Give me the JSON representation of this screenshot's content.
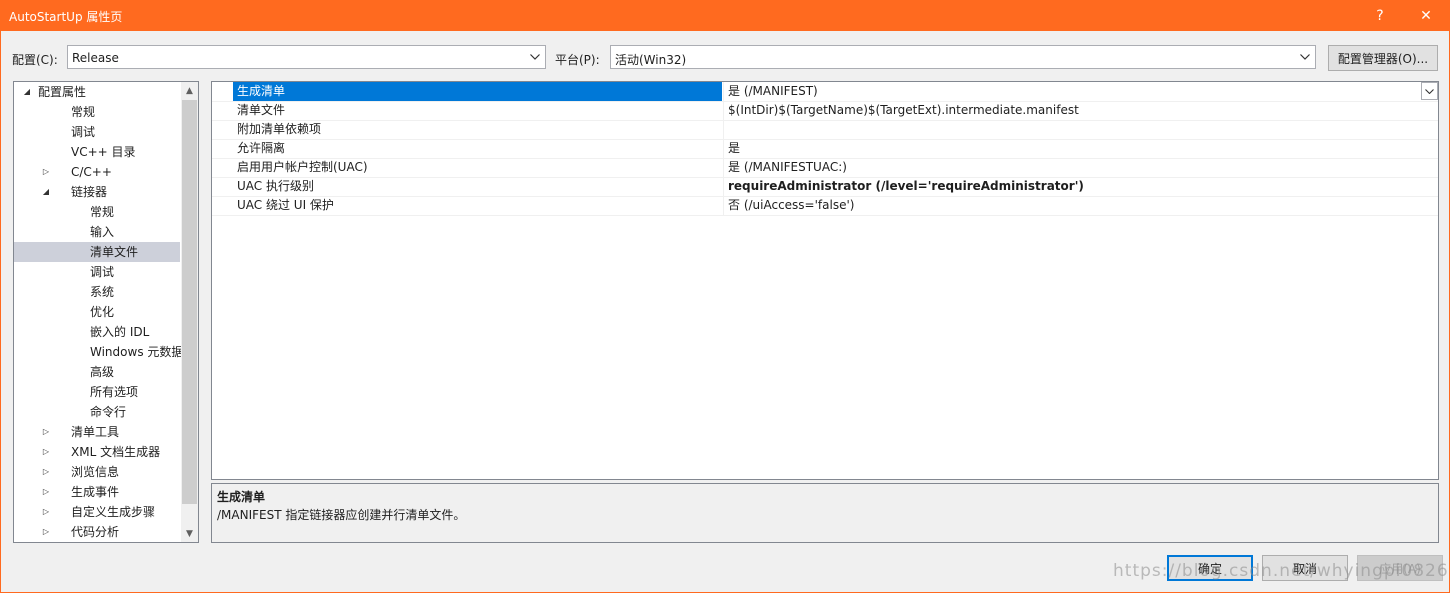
{
  "window": {
    "title": "AutoStartUp 属性页",
    "help_label": "?",
    "close_label": "✕"
  },
  "config": {
    "config_label": "配置(C):",
    "config_value": "Release",
    "platform_label": "平台(P):",
    "platform_value": "活动(Win32)",
    "manager_button": "配置管理器(O)..."
  },
  "tree": {
    "items": [
      {
        "label": "配置属性",
        "level": 0,
        "expander": "◢",
        "selected": false
      },
      {
        "label": "常规",
        "level": 1,
        "expander": "",
        "selected": false
      },
      {
        "label": "调试",
        "level": 1,
        "expander": "",
        "selected": false
      },
      {
        "label": "VC++ 目录",
        "level": 1,
        "expander": "",
        "selected": false
      },
      {
        "label": "C/C++",
        "level": 1,
        "expander": "▷",
        "selected": false
      },
      {
        "label": "链接器",
        "level": 1,
        "expander": "◢",
        "selected": false
      },
      {
        "label": "常规",
        "level": 2,
        "expander": "",
        "selected": false
      },
      {
        "label": "输入",
        "level": 2,
        "expander": "",
        "selected": false
      },
      {
        "label": "清单文件",
        "level": 2,
        "expander": "",
        "selected": true
      },
      {
        "label": "调试",
        "level": 2,
        "expander": "",
        "selected": false
      },
      {
        "label": "系统",
        "level": 2,
        "expander": "",
        "selected": false
      },
      {
        "label": "优化",
        "level": 2,
        "expander": "",
        "selected": false
      },
      {
        "label": "嵌入的 IDL",
        "level": 2,
        "expander": "",
        "selected": false
      },
      {
        "label": "Windows 元数据",
        "level": 2,
        "expander": "",
        "selected": false
      },
      {
        "label": "高级",
        "level": 2,
        "expander": "",
        "selected": false
      },
      {
        "label": "所有选项",
        "level": 2,
        "expander": "",
        "selected": false
      },
      {
        "label": "命令行",
        "level": 2,
        "expander": "",
        "selected": false
      },
      {
        "label": "清单工具",
        "level": 1,
        "expander": "▷",
        "selected": false
      },
      {
        "label": "XML 文档生成器",
        "level": 1,
        "expander": "▷",
        "selected": false
      },
      {
        "label": "浏览信息",
        "level": 1,
        "expander": "▷",
        "selected": false
      },
      {
        "label": "生成事件",
        "level": 1,
        "expander": "▷",
        "selected": false
      },
      {
        "label": "自定义生成步骤",
        "level": 1,
        "expander": "▷",
        "selected": false
      },
      {
        "label": "代码分析",
        "level": 1,
        "expander": "▷",
        "selected": false
      }
    ]
  },
  "grid": {
    "rows": [
      {
        "name": "生成清单",
        "value": "是 (/MANIFEST)",
        "selected": true,
        "bold": false
      },
      {
        "name": "清单文件",
        "value": "$(IntDir)$(TargetName)$(TargetExt).intermediate.manifest",
        "selected": false,
        "bold": false
      },
      {
        "name": "附加清单依赖项",
        "value": "",
        "selected": false,
        "bold": false
      },
      {
        "name": "允许隔离",
        "value": "是",
        "selected": false,
        "bold": false
      },
      {
        "name": "启用用户帐户控制(UAC)",
        "value": "是 (/MANIFESTUAC:)",
        "selected": false,
        "bold": false
      },
      {
        "name": "UAC 执行级别",
        "value": "requireAdministrator (/level='requireAdministrator')",
        "selected": false,
        "bold": true
      },
      {
        "name": "UAC 绕过 UI 保护",
        "value": "否 (/uiAccess='false')",
        "selected": false,
        "bold": false
      }
    ]
  },
  "description": {
    "title": "生成清单",
    "text": "/MANIFEST 指定链接器应创建并行清单文件。"
  },
  "buttons": {
    "ok": "确定",
    "cancel": "取消",
    "apply": "应用(A)"
  },
  "watermark": "https://blog.csdn.net/whyingpi0826",
  "colors": {
    "titlebar": "#ff6a1f",
    "selection": "#0078d7",
    "tree_selection": "#cdd0da"
  }
}
